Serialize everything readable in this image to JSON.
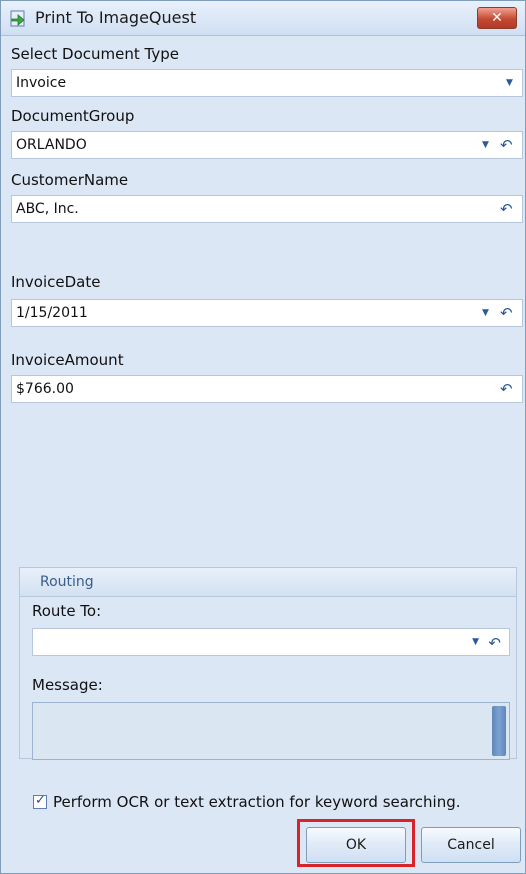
{
  "window": {
    "title": "Print To ImageQuest",
    "close_label": "✕"
  },
  "fields": {
    "doc_type_label": "Select Document Type",
    "doc_type_value": "Invoice",
    "doc_group_label": "DocumentGroup",
    "doc_group_value": "ORLANDO",
    "customer_label": "CustomerName",
    "customer_value": "ABC, Inc.",
    "invoice_date_label": "InvoiceDate",
    "invoice_date_value": "1/15/2011",
    "invoice_amount_label": "InvoiceAmount",
    "invoice_amount_value": "$766.00"
  },
  "routing": {
    "header": "Routing",
    "route_to_label": "Route To:",
    "route_to_value": "",
    "message_label": "Message:",
    "message_value": ""
  },
  "options": {
    "ocr_checked": true,
    "ocr_label": "Perform OCR or text extraction for keyword searching."
  },
  "buttons": {
    "ok": "OK",
    "cancel": "Cancel"
  },
  "icons": {
    "dropdown": "▼",
    "undo": "↶",
    "check": "✓"
  }
}
